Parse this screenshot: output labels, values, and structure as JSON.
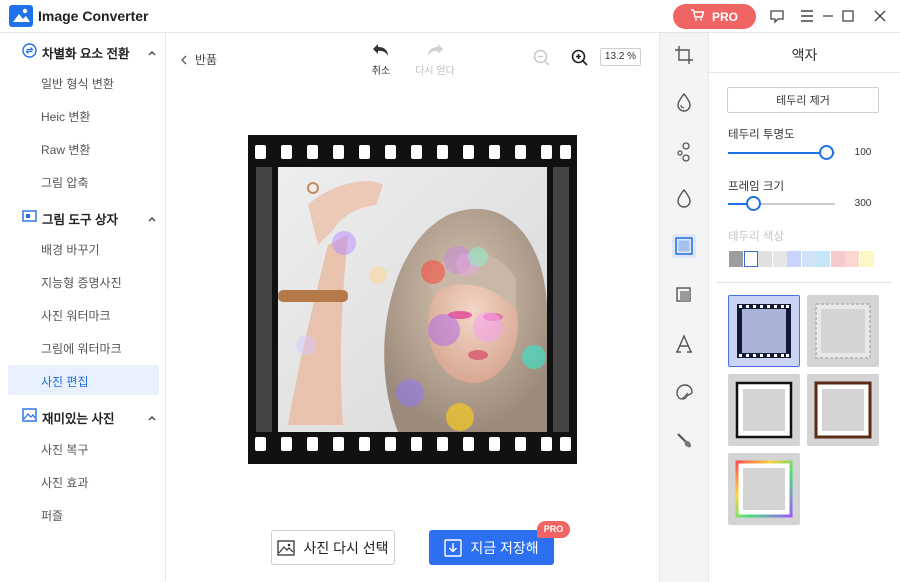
{
  "app": {
    "title": "Image Converter",
    "pro_label": "PRO"
  },
  "sidebar": {
    "sections": [
      {
        "label": "차별화 요소 전환",
        "items": [
          "일반 형식 변환",
          "Heic 변환",
          "Raw 변환",
          "그림 압축"
        ]
      },
      {
        "label": "그림 도구 상자",
        "items": [
          "배경 바꾸기",
          "지능형 증명사진",
          "사진 워터마크",
          "그림에 워터마크",
          "사진 편집"
        ]
      },
      {
        "label": "재미있는 사진",
        "items": [
          "사진 복구",
          "사진 효과",
          "퍼즐"
        ]
      }
    ],
    "active_item": "사진 편집"
  },
  "toolbar": {
    "back_label": "반품",
    "undo_label": "취소",
    "redo_label": "다시 얻다",
    "zoom_level": "13.2 %"
  },
  "panel": {
    "title": "액자",
    "remove_border_label": "테두리 제거",
    "transparency_label": "테두리 투명도",
    "transparency_value": "100",
    "frame_size_label": "프레임 크기",
    "frame_size_value": "300",
    "border_color_label": "테두리 색상",
    "swatches": [
      "#9e9e9e",
      "#ffffff",
      "#e0e0e0",
      "#e6e6e6",
      "#c9d3fb",
      "#cfe3f7",
      "#c5e6f8",
      "#f5caca",
      "#f8d8cf",
      "#fbf7c6"
    ],
    "frame_styles": [
      "film",
      "grey-deckle",
      "black-thin",
      "wood",
      "rainbow"
    ]
  },
  "bottom": {
    "reselect_label": "사진 다시 선택",
    "save_label": "지금 저장해",
    "save_badge": "PRO"
  },
  "colors": {
    "accent": "#1f6fe5",
    "pro": "#f06463",
    "save_button": "#2c6ff0"
  }
}
